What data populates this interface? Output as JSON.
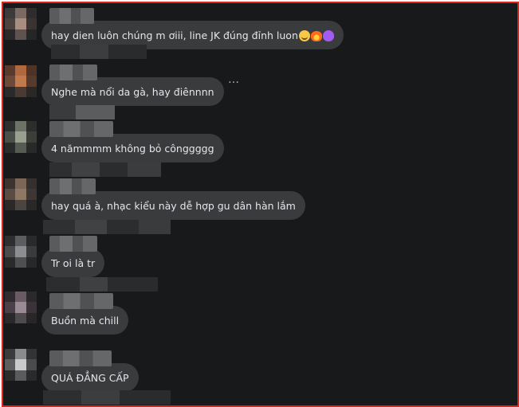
{
  "comments": [
    {
      "text": "hay dien luôn chúng m ơiii, line JK đúng đỉnh luon",
      "emojis": [
        "crying-face-emoji",
        "fire-emoji",
        "purple-heart-emoji"
      ]
    },
    {
      "text": "Nghe mà nổi da gà, hay điênnnn",
      "more": "…"
    },
    {
      "text": "4 nămmmm không bỏ cônggggg"
    },
    {
      "text": "hay quá à, nhạc kiểu này dễ hợp gu dân hàn lắm"
    },
    {
      "text": "Tr oi là tr"
    },
    {
      "text": "Buồn mà chill"
    },
    {
      "text": "QUÁ ĐẲNG CẤP"
    }
  ],
  "colors": {
    "frame_border": "#e2231a",
    "background": "#18191a",
    "bubble": "#3a3b3c",
    "text": "#e4e6eb"
  }
}
